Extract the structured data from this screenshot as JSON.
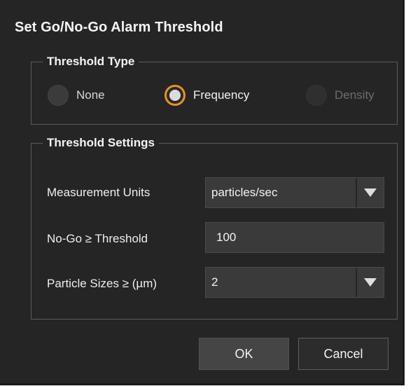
{
  "dialog": {
    "title": "Set Go/No-Go Alarm Threshold"
  },
  "threshold_type": {
    "legend": "Threshold Type",
    "options": [
      {
        "label": "None",
        "selected": false,
        "enabled": true
      },
      {
        "label": "Frequency",
        "selected": true,
        "enabled": true
      },
      {
        "label": "Density",
        "selected": false,
        "enabled": false
      }
    ]
  },
  "threshold_settings": {
    "legend": "Threshold Settings",
    "measurement_units": {
      "label": "Measurement Units",
      "value": "particles/sec"
    },
    "no_go_threshold": {
      "label": "No-Go ≥ Threshold",
      "value": "100"
    },
    "particle_sizes": {
      "label": "Particle Sizes ≥ (µm)",
      "value": "2"
    }
  },
  "buttons": {
    "ok": "OK",
    "cancel": "Cancel"
  },
  "colors": {
    "background": "#252526",
    "accent": "#e8902a",
    "text": "#f2f2f2",
    "disabled_text": "#6d6d6d"
  }
}
